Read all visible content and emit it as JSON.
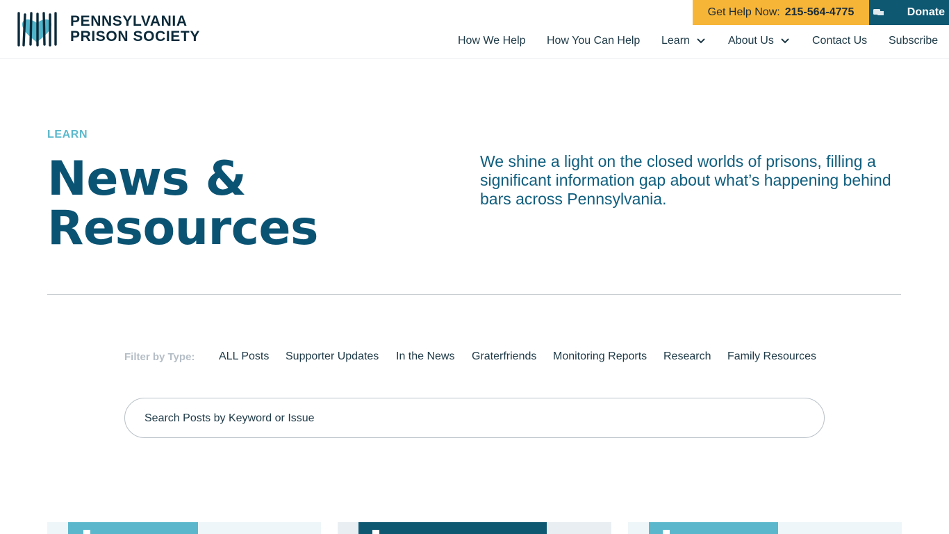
{
  "header": {
    "logo": {
      "line1": "PENNSYLVANIA",
      "line2": "PRISON SOCIETY",
      "icon": "prison-bars-heart-icon"
    },
    "help": {
      "label": "Get Help Now:",
      "phone": "215-564-4775"
    },
    "donate": {
      "label": "Donate",
      "icon": "hand-heart-icon"
    },
    "nav": [
      {
        "label": "How We Help",
        "dropdown": false
      },
      {
        "label": "How You Can Help",
        "dropdown": false
      },
      {
        "label": "Learn",
        "dropdown": true
      },
      {
        "label": "About Us",
        "dropdown": true
      },
      {
        "label": "Contact Us",
        "dropdown": false
      },
      {
        "label": "Subscribe",
        "dropdown": false
      }
    ]
  },
  "hero": {
    "eyebrow": "LEARN",
    "title": "News & Resources",
    "lede": "We shine a light on the closed worlds of prisons, filling a significant information gap about what’s happening behind bars across Pennsylvania."
  },
  "filters": {
    "label": "Filter by Type:",
    "items": [
      "ALL Posts",
      "Supporter Updates",
      "In the News",
      "Graterfriends",
      "Monitoring Reports",
      "Research",
      "Family Resources"
    ]
  },
  "search": {
    "placeholder": "Search Posts by Keyword or Issue",
    "value": ""
  },
  "colors": {
    "brand_dark": "#0b5373",
    "accent_light": "#5bb8cc",
    "help_bar": "#f7b538",
    "donate_bg": "#0f5872"
  }
}
